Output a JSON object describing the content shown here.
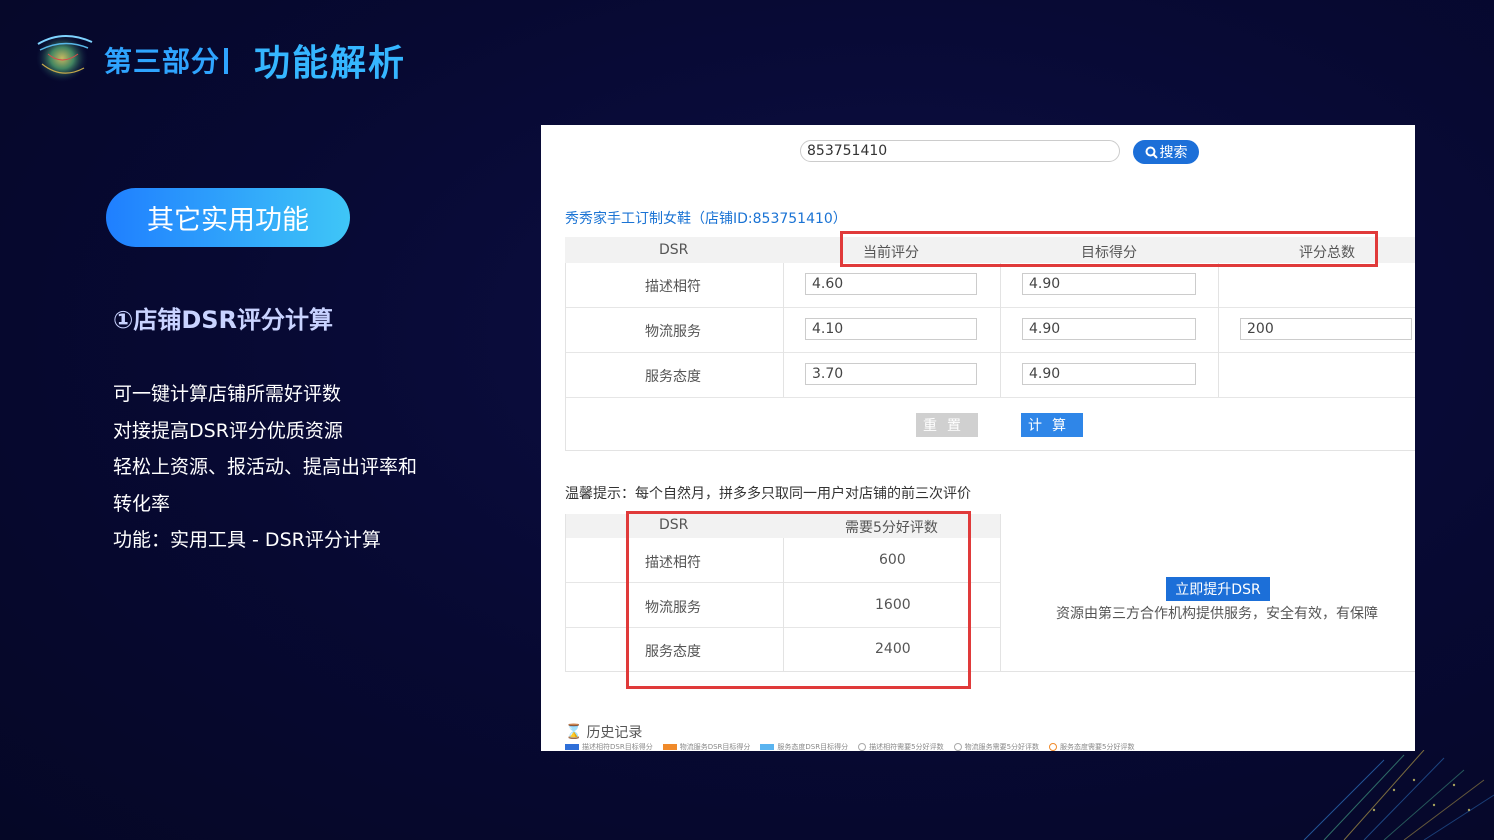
{
  "header": {
    "section": "第三部分",
    "title": "功能解析"
  },
  "left": {
    "pill": "其它实用功能",
    "subheading": "①店铺DSR评分计算",
    "lines": [
      "可一键计算店铺所需好评数",
      "对接提高DSR评分优质资源",
      "轻松上资源、报活动、提高出评率和",
      "转化率",
      "功能：实用工具 - DSR评分计算"
    ]
  },
  "screenshot": {
    "search_value": "853751410",
    "search_button": "搜索",
    "shop_name": "秀秀家手工订制女鞋（店铺ID:853751410）",
    "table1": {
      "headers": [
        "DSR",
        "当前评分",
        "目标得分",
        "评分总数"
      ],
      "rows": [
        {
          "label": "描述相符",
          "current": "4.60",
          "target": "4.90"
        },
        {
          "label": "物流服务",
          "current": "4.10",
          "target": "4.90"
        },
        {
          "label": "服务态度",
          "current": "3.70",
          "target": "4.90"
        }
      ],
      "total": "200"
    },
    "reset_button": "重置",
    "calc_button": "计算",
    "tip": "温馨提示：每个自然月，拼多多只取同一用户对店铺的前三次评价",
    "table2": {
      "headers": [
        "DSR",
        "需要5分好评数"
      ],
      "rows": [
        {
          "label": "描述相符",
          "value": "600"
        },
        {
          "label": "物流服务",
          "value": "1600"
        },
        {
          "label": "服务态度",
          "value": "2400"
        }
      ]
    },
    "boost_button": "立即提升DSR",
    "boost_note": "资源由第三方合作机构提供服务，安全有效，有保障",
    "history": "历史记录",
    "legend": [
      "描述相符DSR目标得分",
      "物流服务DSR目标得分",
      "服务态度DSR目标得分",
      "描述相符需要5分好评数",
      "物流服务需要5分好评数",
      "服务态度需要5分好评数"
    ],
    "legend_colors": [
      "#2f6fd8",
      "#f08a2a",
      "#5ab4f0"
    ],
    "highlight_color": "#e03a3a"
  }
}
